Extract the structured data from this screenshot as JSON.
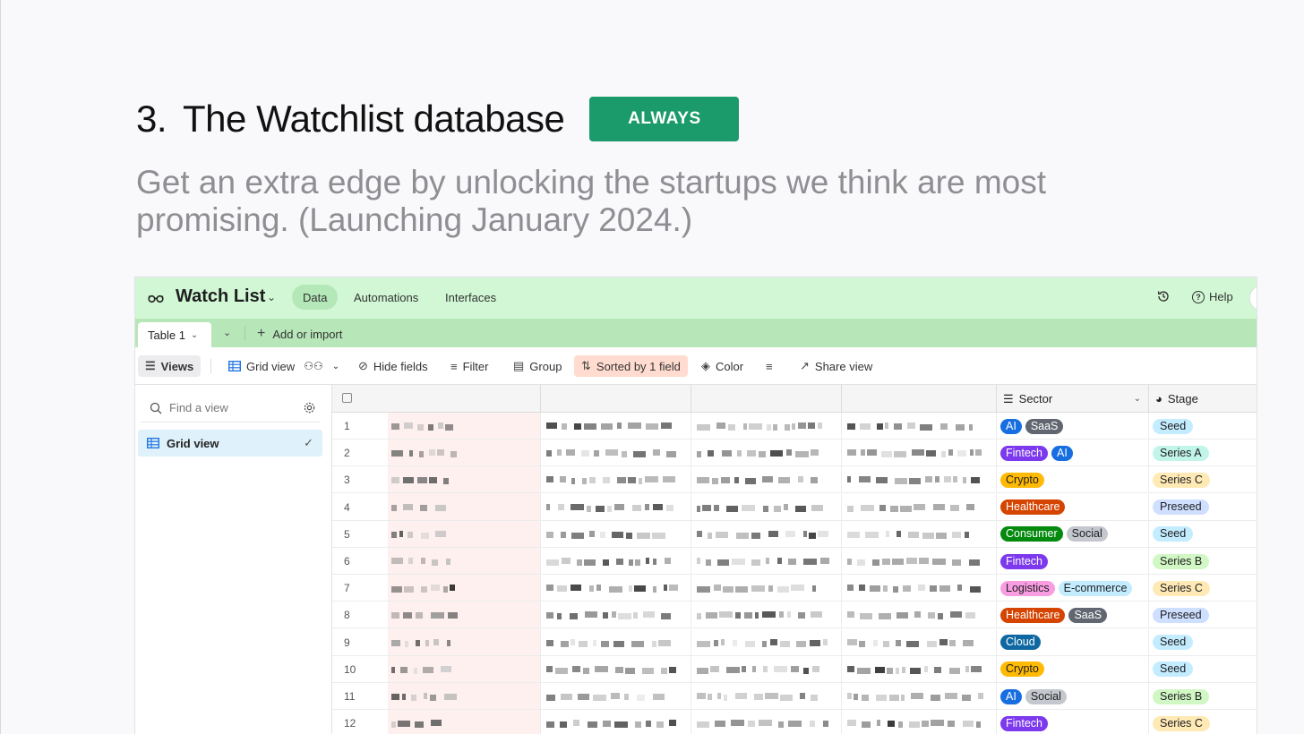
{
  "heading": {
    "number": "3.",
    "title": "The Watchlist database",
    "badge": "ALWAYS",
    "subtitle": "Get an extra edge by unlocking the startups we think are most promising. (Launching January 2024.)"
  },
  "colors": {
    "badge": "#1b9a6b",
    "topbar": "#d1f7d4",
    "tabbar": "#b7e7b9",
    "sorted_highlight": "#ffdccf",
    "selected_view": "#dff1fa"
  },
  "app": {
    "base_name": "Watch List",
    "nav": [
      "Data",
      "Automations",
      "Interfaces"
    ],
    "active_nav": "Data",
    "help_label": "Help",
    "table_tab": "Table 1",
    "add_import": "Add or import",
    "toolbar": {
      "views": "Views",
      "grid_view": "Grid view",
      "hide_fields": "Hide fields",
      "filter": "Filter",
      "group": "Group",
      "sorted": "Sorted by 1 field",
      "color": "Color",
      "share": "Share view"
    },
    "sidebar": {
      "find_placeholder": "Find a view",
      "views": [
        "Grid view"
      ]
    },
    "columns": {
      "sector": "Sector",
      "stage": "Stage"
    },
    "rows": [
      {
        "n": "1",
        "sectors": [
          "AI",
          "SaaS"
        ],
        "stage": "Seed"
      },
      {
        "n": "2",
        "sectors": [
          "Fintech",
          "AI"
        ],
        "stage": "Series A"
      },
      {
        "n": "3",
        "sectors": [
          "Crypto"
        ],
        "stage": "Series C"
      },
      {
        "n": "4",
        "sectors": [
          "Healthcare"
        ],
        "stage": "Preseed"
      },
      {
        "n": "5",
        "sectors": [
          "Consumer",
          "Social"
        ],
        "stage": "Seed"
      },
      {
        "n": "6",
        "sectors": [
          "Fintech"
        ],
        "stage": "Series B"
      },
      {
        "n": "7",
        "sectors": [
          "Logistics",
          "E-commerce"
        ],
        "stage": "Series C"
      },
      {
        "n": "8",
        "sectors": [
          "Healthcare",
          "SaaS"
        ],
        "stage": "Preseed"
      },
      {
        "n": "9",
        "sectors": [
          "Cloud"
        ],
        "stage": "Seed"
      },
      {
        "n": "10",
        "sectors": [
          "Crypto"
        ],
        "stage": "Seed"
      },
      {
        "n": "11",
        "sectors": [
          "AI",
          "Social"
        ],
        "stage": "Series B"
      },
      {
        "n": "12",
        "sectors": [
          "Fintech"
        ],
        "stage": "Series C"
      }
    ],
    "sector_colors": {
      "AI": {
        "bg": "#166ee1",
        "fg": "#ffffff"
      },
      "SaaS": {
        "bg": "#616670",
        "fg": "#ffffff"
      },
      "Fintech": {
        "bg": "#7c39ed",
        "fg": "#ffffff"
      },
      "Crypto": {
        "bg": "#ffba05",
        "fg": "#1d1d1f"
      },
      "Healthcare": {
        "bg": "#d54401",
        "fg": "#ffffff"
      },
      "Consumer": {
        "bg": "#048a0e",
        "fg": "#ffffff"
      },
      "Social": {
        "bg": "#c4c7cd",
        "fg": "#1d1d1f"
      },
      "Logistics": {
        "bg": "#f99de2",
        "fg": "#1d1d1f"
      },
      "E-commerce": {
        "bg": "#c4ecff",
        "fg": "#1d1d1f"
      },
      "Cloud": {
        "bg": "#0f68a2",
        "fg": "#ffffff"
      }
    },
    "stage_colors": {
      "Seed": "#c4ecff",
      "Series A": "#c2f5e9",
      "Series B": "#d1f7c4",
      "Series C": "#ffeab6",
      "Preseed": "#cfdfff"
    }
  }
}
